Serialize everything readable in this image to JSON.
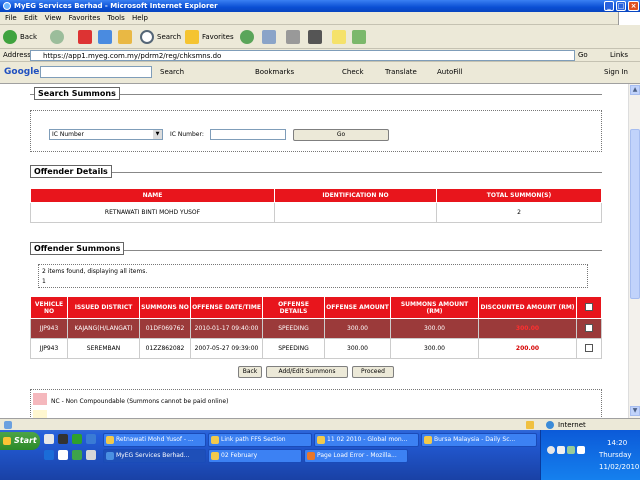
{
  "window": {
    "title": "MyEG Services Berhad - Microsoft Internet Explorer"
  },
  "menu": [
    "File",
    "Edit",
    "View",
    "Favorites",
    "Tools",
    "Help"
  ],
  "toolbar": {
    "back": "Back",
    "search": "Search",
    "favorites": "Favorites"
  },
  "address": {
    "label": "Address",
    "url": "https://app1.myeg.com.my/pdrm2/reg/chksmns.do",
    "go": "Go",
    "links": "Links"
  },
  "googlebar": {
    "logo": "Google",
    "search": "Search",
    "bookmarks": "Bookmarks",
    "check": "Check",
    "translate": "Translate",
    "autofill": "AutoFill",
    "signin": "Sign In"
  },
  "search_summons": {
    "legend": "Search Summons",
    "select_value": "IC Number",
    "ic_label": "IC Number:",
    "ic_value": "",
    "go": "Go"
  },
  "offender_details": {
    "legend": "Offender Details",
    "headers": [
      "NAME",
      "IDENTIFICATION NO",
      "TOTAL SUMMON(S)"
    ],
    "row": {
      "name": "RETNAWATI BINTI MOHD YUSOF",
      "id": "",
      "total": "2"
    }
  },
  "offender_summons": {
    "legend": "Offender Summons",
    "found_text": "2 items found, displaying all items.",
    "page": "1",
    "headers": [
      "VEHICLE NO",
      "ISSUED DISTRICT",
      "SUMMONS NO",
      "OFFENSE DATE/TIME",
      "OFFENSE DETAILS",
      "OFFENSE AMOUNT",
      "SUMMONS AMOUNT (RM)",
      "DISCOUNTED AMOUNT (RM)"
    ],
    "rows": [
      {
        "vehicle": "JJP943",
        "district": "KAJANG(H/LANGAT)",
        "summons": "01DF069762",
        "datetime": "2010-01-17 09:40:00",
        "details": "SPEEDING",
        "offense_amount": "300.00",
        "summons_amount": "300.00",
        "discounted": "300.00",
        "checked": false,
        "highlight": true
      },
      {
        "vehicle": "JJP943",
        "district": "SEREMBAN",
        "summons": "01ZZ862082",
        "datetime": "2007-05-27 09:39:00",
        "details": "SPEEDING",
        "offense_amount": "300.00",
        "summons_amount": "300.00",
        "discounted": "200.00",
        "checked": false,
        "highlight": false
      }
    ]
  },
  "buttons": {
    "back": "Back",
    "add_edit": "Add/Edit Summons",
    "proceed": "Proceed"
  },
  "legend_note": "NC - Non Compoundable (Summons cannot be paid online)",
  "status": {
    "zone": "Internet"
  },
  "taskbar": {
    "start": "Start",
    "tasks_row1": [
      "Retnawati Mohd Yusof - ...",
      "Link path FFS Section",
      "11 02 2010 - Global mon...",
      "Bursa Malaysia - Daily Sc..."
    ],
    "tasks_row2": [
      "MyEG Services Berhad...",
      "02 February",
      "Page Load Error - Mozilla..."
    ],
    "time": "14:20",
    "day": "Thursday",
    "date": "11/02/2010"
  },
  "colors": {
    "header_red": "#e8151c",
    "highlight_row": "#9b3a3a",
    "discount_red": "#d40000",
    "nc_pink": "#f5b8bd"
  }
}
